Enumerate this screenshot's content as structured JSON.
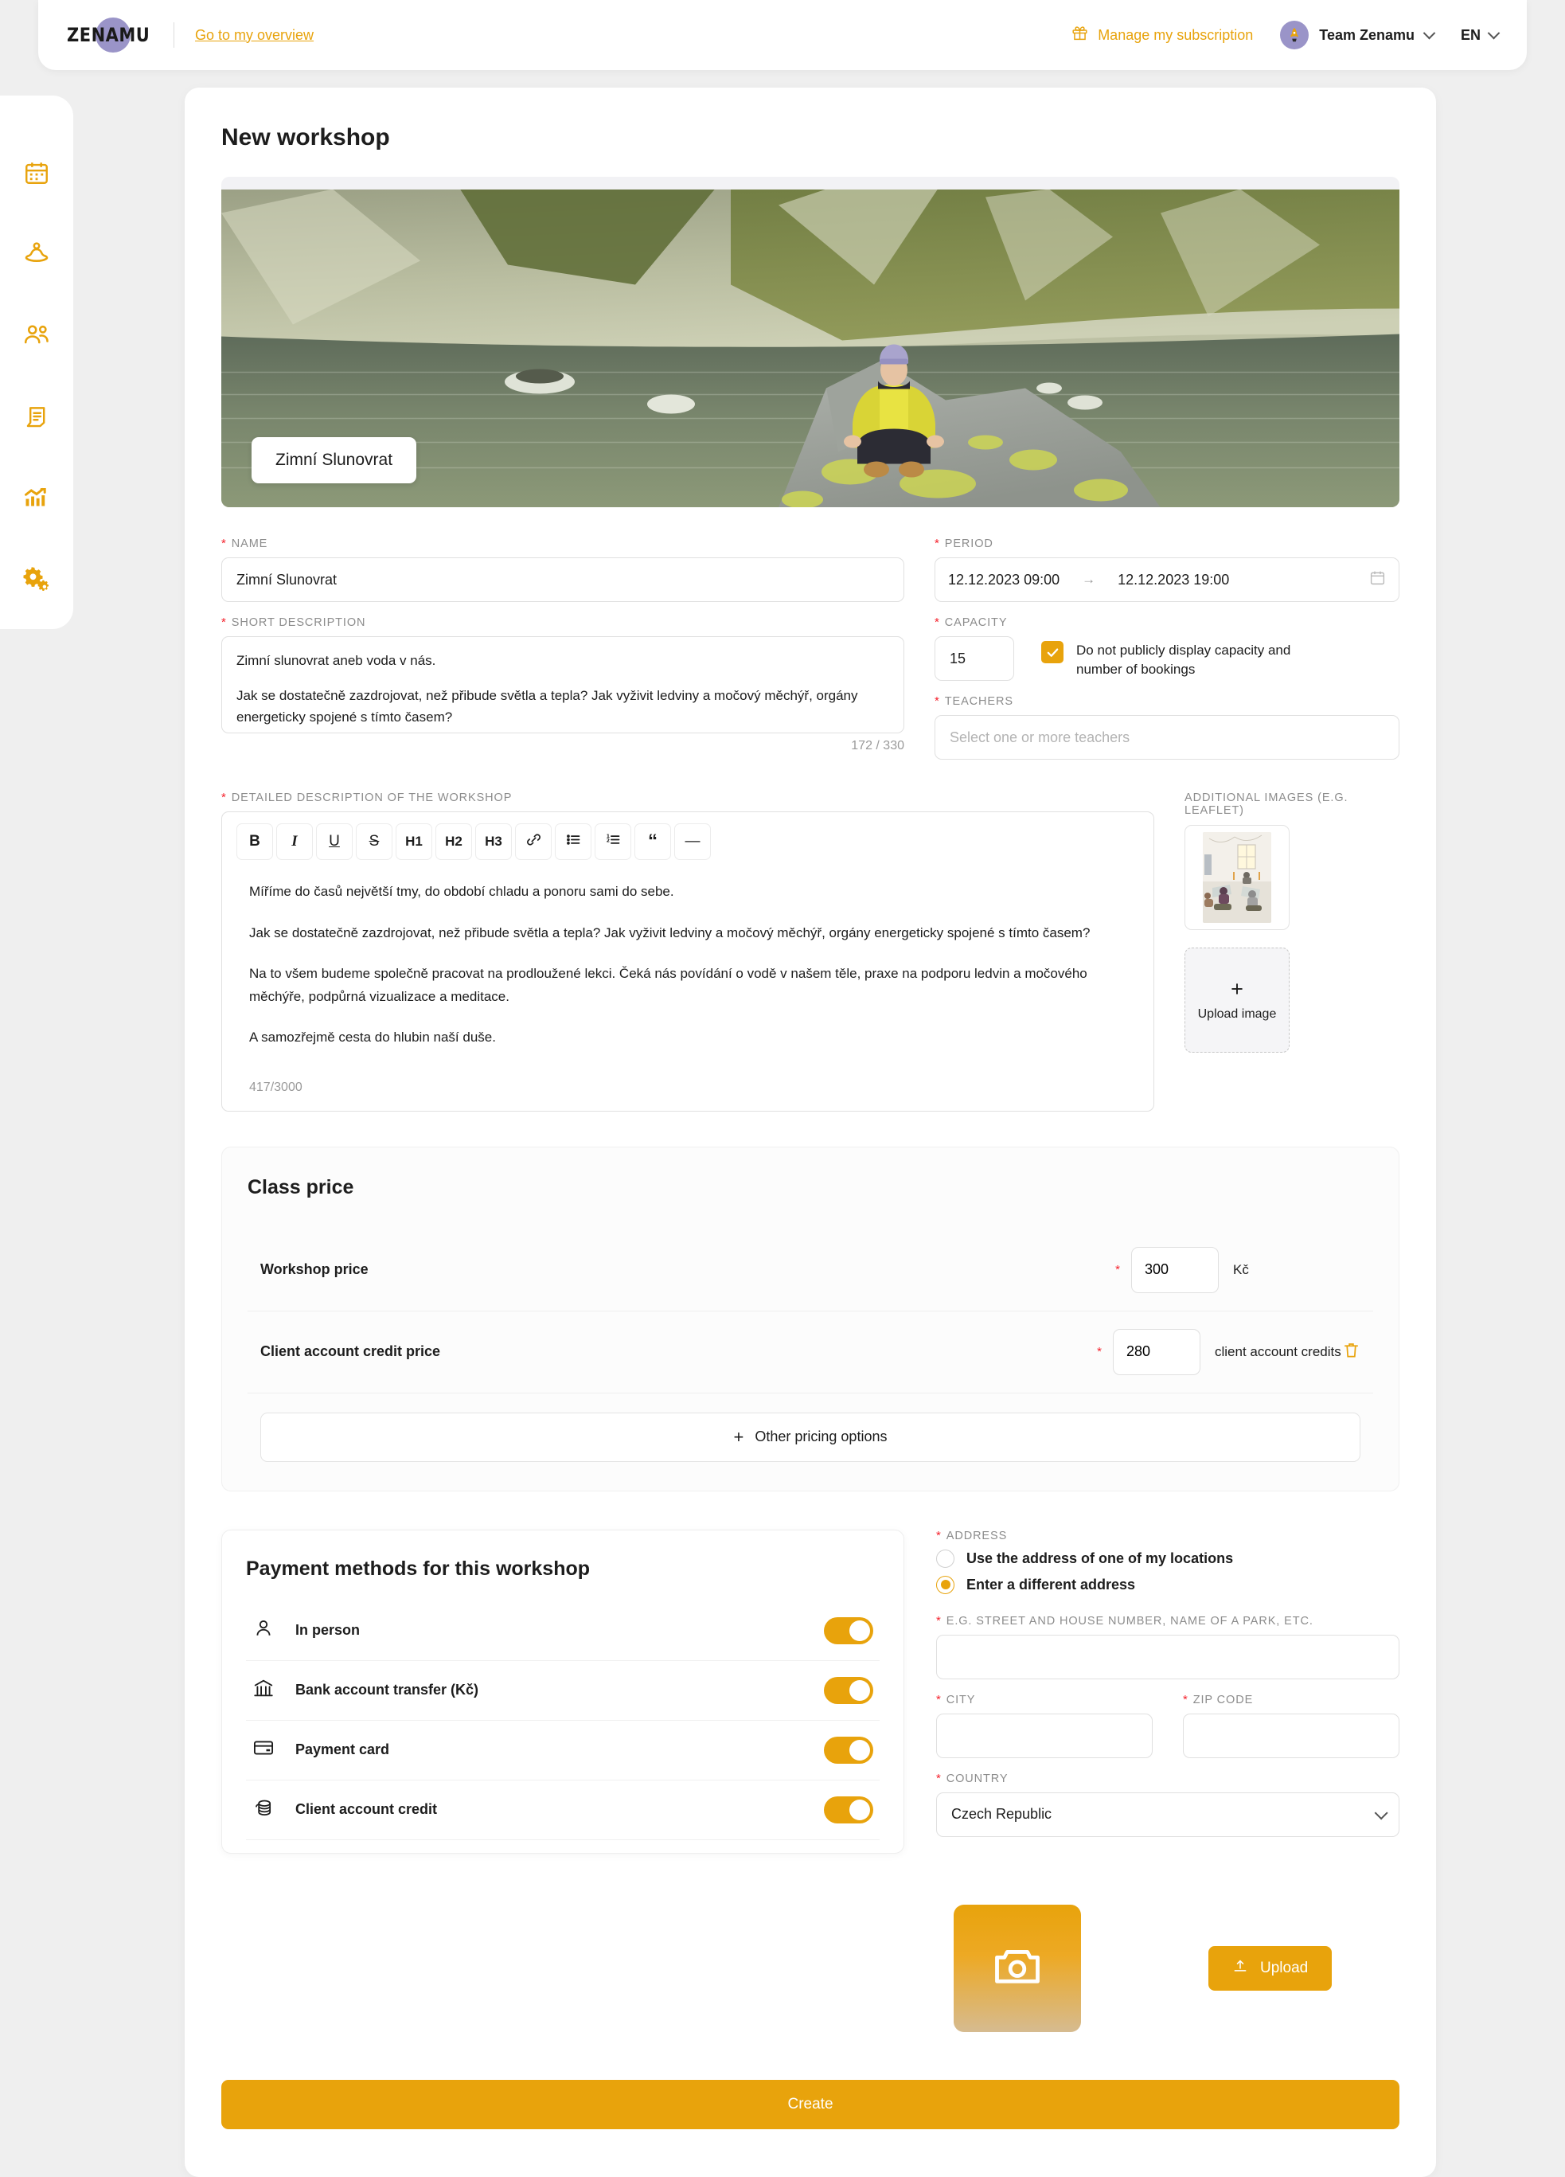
{
  "topbar": {
    "logo_text": "ZENAMU",
    "logo_icon": "zenamu-logo",
    "overview_link": "Go to my overview",
    "subscription_label": "Manage my subscription",
    "subscription_icon": "gift-icon",
    "team_name": "Team Zenamu",
    "avatar_icon": "rocket-avatar",
    "language": "EN"
  },
  "sidebar": {
    "items": [
      {
        "icon": "calendar-icon",
        "name": "calendar"
      },
      {
        "icon": "yoga-meditation-icon",
        "name": "classes"
      },
      {
        "icon": "people-icon",
        "name": "clients"
      },
      {
        "icon": "invoice-document-icon",
        "name": "invoices"
      },
      {
        "icon": "bar-chart-icon",
        "name": "statistics"
      },
      {
        "icon": "gears-settings-icon",
        "name": "settings"
      }
    ]
  },
  "main": {
    "page_title": "New workshop",
    "hero": {
      "chip_label": "Zimní Slunovrat",
      "alt": "woman in yellow jacket meditating on a rock by a mountain lake"
    },
    "name": {
      "label": "NAME",
      "required": "*",
      "value": "Zimní Slunovrat"
    },
    "short_description": {
      "label": "SHORT DESCRIPTION",
      "required": "*",
      "line1": "Zimní slunovrat aneb voda v nás.",
      "line2": "Jak se dostatečně zazdrojovat, než přibude světla a tepla? Jak vyživit ledviny a močový měchýř, orgány energeticky spojené s tímto časem?",
      "counter": "172 / 330"
    },
    "period": {
      "label": "PERIOD",
      "required": "*",
      "start": "12.12.2023 09:00",
      "end": "12.12.2023 19:00",
      "separator": "→",
      "icon": "calendar-icon"
    },
    "capacity": {
      "label": "CAPACITY",
      "required": "*",
      "value": "15",
      "checkbox_label": "Do not publicly display capacity and number of bookings",
      "checkbox_checked": true
    },
    "teachers": {
      "label": "TEACHERS",
      "required": "*",
      "placeholder": "Select one or more teachers",
      "value": ""
    },
    "detailed_description": {
      "label": "DETAILED DESCRIPTION OF THE WORKSHOP",
      "required": "*",
      "toolbar": [
        {
          "label": "B",
          "name": "bold"
        },
        {
          "label": "I",
          "name": "italic"
        },
        {
          "label": "U",
          "name": "underline"
        },
        {
          "label": "S",
          "name": "strikethrough"
        },
        {
          "label": "H1",
          "name": "heading-1"
        },
        {
          "label": "H2",
          "name": "heading-2"
        },
        {
          "label": "H3",
          "name": "heading-3"
        },
        {
          "label": "🔗",
          "name": "link"
        },
        {
          "label": "☰",
          "name": "bullet-list"
        },
        {
          "label": "⒈",
          "name": "numbered-list"
        },
        {
          "label": "“",
          "name": "blockquote"
        },
        {
          "label": "—",
          "name": "horizontal-rule"
        }
      ],
      "paragraphs": [
        "Míříme do časů největší tmy, do období chladu a ponoru sami do sebe.",
        "Jak se dostatečně zazdrojovat, než přibude světla a tepla? Jak vyživit ledviny a močový měchýř, orgány energeticky spojené s tímto časem?",
        "Na to všem budeme společně pracovat na prodloužené lekci. Čeká nás povídání o vodě v našem těle, praxe na podporu ledvin a močového měchýře, podpůrná vizualizace a meditace.",
        "A samozřejmě cesta do hlubin naší duše."
      ],
      "counter": "417/3000"
    },
    "additional_images": {
      "label": "ADDITIONAL IMAGES (E.G. LEAFLET)",
      "thumb_alt": "yoga studio room with students sitting on mats",
      "upload_label": "Upload image",
      "upload_plus": "+"
    },
    "class_price": {
      "title": "Class price",
      "rows": [
        {
          "name": "Workshop price",
          "required": "*",
          "value": "300",
          "unit": "Kč",
          "deletable": false
        },
        {
          "name": "Client account credit price",
          "required": "*",
          "value": "280",
          "unit": "client account credits",
          "deletable": true
        }
      ],
      "other_options_label": "Other pricing options",
      "other_options_plus": "+",
      "delete_icon": "trash-icon"
    },
    "payment_methods": {
      "title": "Payment methods for this workshop",
      "rows": [
        {
          "label": "In person",
          "icon": "person-icon",
          "enabled": true
        },
        {
          "label": "Bank account transfer (Kč)",
          "icon": "bank-icon",
          "enabled": true
        },
        {
          "label": "Payment card",
          "icon": "credit-card-icon",
          "enabled": true
        },
        {
          "label": "Client account credit",
          "icon": "coins-icon",
          "enabled": true
        }
      ]
    },
    "address": {
      "label": "ADDRESS",
      "required": "*",
      "option_existing": "Use the address of one of my locations",
      "option_different": "Enter a different address",
      "selected": "different",
      "street": {
        "label": "E.G. STREET AND HOUSE NUMBER, NAME OF A PARK, ETC.",
        "required": "*",
        "value": ""
      },
      "city": {
        "label": "CITY",
        "required": "*",
        "value": ""
      },
      "zip": {
        "label": "ZIP CODE",
        "required": "*",
        "value": ""
      },
      "country": {
        "label": "COUNTRY",
        "required": "*",
        "value": "Czech Republic"
      }
    },
    "media": {
      "camera_icon": "camera-icon",
      "upload_label": "Upload",
      "upload_icon": "upload-icon"
    },
    "create_button": "Create"
  },
  "colors": {
    "accent": "#e8a30c",
    "brand_purple": "#9a94c8",
    "required_red": "#f5222d",
    "page_bg": "#efefef"
  }
}
